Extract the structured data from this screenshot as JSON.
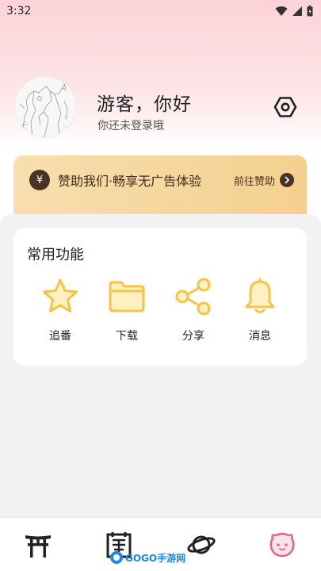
{
  "status_bar": {
    "time": "3:32"
  },
  "profile": {
    "greeting": "游客，你好",
    "subtitle": "你还未登录哦"
  },
  "sponsor": {
    "icon": "yen-icon",
    "icon_glyph": "¥",
    "text": "赞助我们·畅享无广告体验",
    "link_label": "前往赞助"
  },
  "common_functions": {
    "title": "常用功能",
    "items": [
      {
        "label": "追番",
        "icon": "star-icon"
      },
      {
        "label": "下载",
        "icon": "folder-icon"
      },
      {
        "label": "分享",
        "icon": "share-icon"
      },
      {
        "label": "消息",
        "icon": "bell-icon"
      }
    ]
  },
  "bottom_nav": {
    "items": [
      {
        "icon": "torii-icon"
      },
      {
        "icon": "schedule-icon"
      },
      {
        "icon": "planet-icon"
      },
      {
        "icon": "profile-face-icon",
        "active": true
      }
    ]
  },
  "watermark": {
    "text": "GOGO手游网"
  },
  "colors": {
    "accent_yellow": "#f6c445",
    "sponsor_bg": "#f5d89c",
    "sponsor_dark": "#4a3326",
    "active_nav": "#e8638a"
  }
}
